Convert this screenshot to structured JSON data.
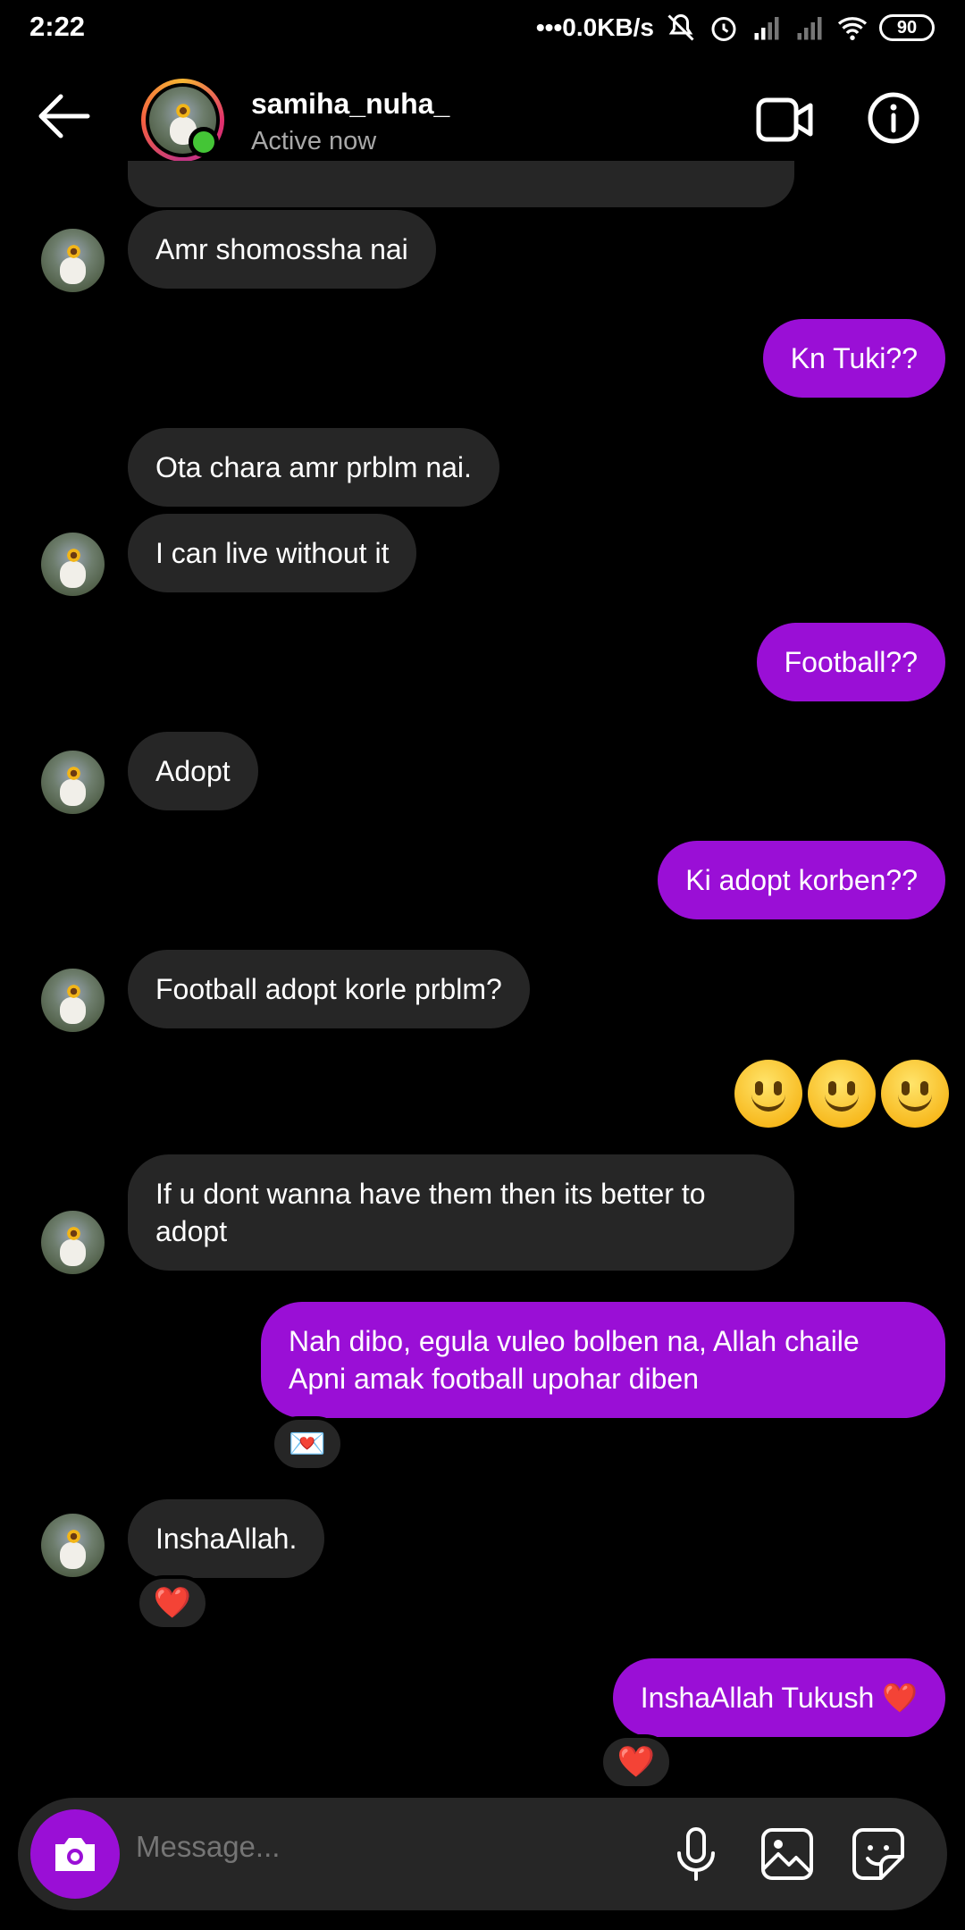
{
  "status_bar": {
    "time": "2:22",
    "network_speed": "0.0KB/s",
    "battery": "90",
    "icons": [
      "dots-icon",
      "mute-icon",
      "alarm-icon",
      "signal-icon",
      "signal-icon",
      "wifi-icon",
      "battery-icon"
    ]
  },
  "header": {
    "username": "samiha_nuha_",
    "status": "Active now",
    "icons": [
      "back-arrow-icon",
      "video-camera-icon",
      "info-icon"
    ],
    "online_color": "#44c536"
  },
  "colors": {
    "sent_bubble": "#9a0fd6",
    "received_bubble": "#262626",
    "background": "#000000"
  },
  "messages": [
    {
      "from": "them",
      "text": "Amr shomossha nai"
    },
    {
      "from": "me",
      "text": "Kn Tuki??"
    },
    {
      "from": "them",
      "text": "Ota chara amr prblm nai."
    },
    {
      "from": "them",
      "text": "I can live without it"
    },
    {
      "from": "me",
      "text": "Football??"
    },
    {
      "from": "them",
      "text": "Adopt"
    },
    {
      "from": "me",
      "text": "Ki adopt korben??"
    },
    {
      "from": "them",
      "text": "Football adopt korle prblm?"
    },
    {
      "from": "me",
      "text": "🙂🙂🙂"
    },
    {
      "from": "them",
      "text": "If u dont wanna have them then its better to adopt"
    },
    {
      "from": "me",
      "text": "Nah dibo, egula vuleo bolben na, Allah chaile Apni amak football upohar diben",
      "reaction": "💌"
    },
    {
      "from": "them",
      "text": "InshaAllah.",
      "reaction": "❤️"
    },
    {
      "from": "me",
      "text": "InshaAllah Tukush ❤️",
      "reaction": "❤️"
    }
  ],
  "composer": {
    "placeholder": "Message...",
    "icons": [
      "camera-icon",
      "microphone-icon",
      "gallery-icon",
      "sticker-icon"
    ]
  }
}
